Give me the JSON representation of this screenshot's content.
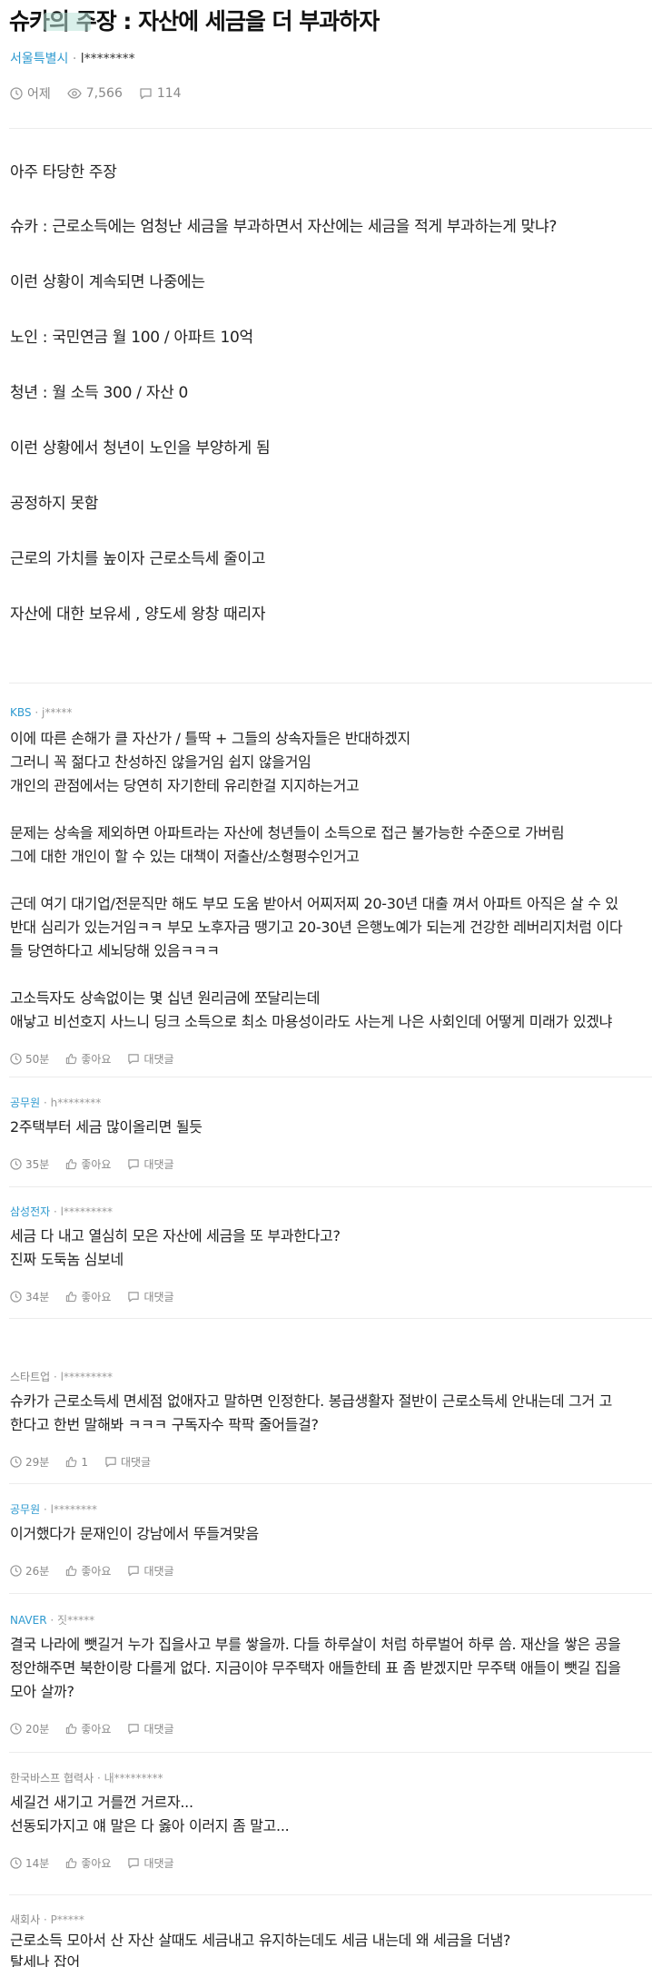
{
  "post": {
    "title": "슈카의 주장 : 자산에 세금을 더 부과하자",
    "company": "서울특별시",
    "separator": "·",
    "author_id": "l********",
    "time": "어제",
    "views": "7,566",
    "comments": "114",
    "body": [
      "아주 타당한 주장",
      "슈카 : 근로소득에는 엄청난 세금을 부과하면서 자산에는 세금을 적게 부과하는게 맞냐?",
      "이런 상황이 계속되면 나중에는",
      "노인 : 국민연금 월 100 / 아파트 10억",
      "청년 : 월 소득 300 / 자산 0",
      "이런 상황에서 청년이 노인을 부양하게 됨",
      "공정하지 못함",
      "근로의 가치를 높이자 근로소득세 줄이고",
      "자산에 대한 보유세 , 양도세 왕창 때리자"
    ]
  },
  "comments": [
    {
      "company": "KBS",
      "author_id": "j*****",
      "lines": [
        "이에 따른 손해가 클 자산가 / 틀딱 + 그들의 상속자들은 반대하겠지",
        "그러니 꼭 젊다고 찬성하진 않을거임 쉽지 않을거임",
        "개인의 관점에서는 당연히 자기한테 유리한걸 지지하는거고",
        "",
        "문제는 상속을 제외하면 아파트라는 자산에 청년들이 소득으로 접근 불가능한 수준으로 가버림",
        "그에 대한 개인이 할 수 있는 대책이 저출산/소형평수인거고",
        "",
        "근데 여기 대기업/전문직만 해도 부모 도움 받아서 어찌저찌 20-30년 대출 껴서 아파트 아직은 살 수 있",
        "반대 심리가 있는거임ㅋㅋ 부모 노후자금 땡기고 20-30년 은행노예가 되는게 건강한 레버리지처럼 이다",
        "들 당연하다고 세뇌당해 있음ㅋㅋㅋ",
        "",
        "고소득자도 상속없이는 몇 십년 원리금에 쪼달리는데",
        "애낳고 비선호지 사느니 딩크 소득으로 최소 마용성이라도 사는게 나은 사회인데 어떻게 미래가 있겠냐"
      ],
      "time": "50분",
      "likes": "좋아요",
      "reply": "대댓글"
    },
    {
      "company": "공무원",
      "author_id": "h********",
      "lines": [
        "2주택부터 세금 많이올리면 될듯"
      ],
      "time": "35분",
      "likes": "좋아요",
      "reply": "대댓글"
    },
    {
      "company": "삼성전자",
      "author_id": "l*********",
      "lines": [
        "세금 다 내고 열심히 모은 자산에 세금을 또 부과한다고?",
        "진짜 도둑놈 심보네"
      ],
      "time": "34분",
      "likes": "좋아요",
      "reply": "대댓글"
    },
    {
      "company": "스타트업",
      "author_id": "l*********",
      "lines": [
        "슈카가 근로소득세 면세점 없애자고 말하면 인정한다. 봉급생활자 절반이 근로소득세 안내는데 그거 고",
        "한다고 한번 말해봐 ㅋㅋㅋ 구독자수 팍팍 줄어들걸?"
      ],
      "time": "29분",
      "likes": "1",
      "reply": "대댓글"
    },
    {
      "company": "공무원",
      "author_id": "l********",
      "lines": [
        "이거했다가 문재인이 강남에서 뚜들겨맞음"
      ],
      "time": "26분",
      "likes": "좋아요",
      "reply": "대댓글"
    },
    {
      "company": "NAVER",
      "author_id": "짓*****",
      "lines": [
        "결국 나라에 뺏길거 누가 집을사고 부를 쌓을까. 다들 하루살이 처럼 하루벌어 하루 씀. 재산을 쌓은 공을",
        "정안해주면 북한이랑 다를게 없다. 지금이야 무주택자 애들한테 표 좀 받겠지만 무주택 애들이 뺏길 집을",
        "모아 살까?"
      ],
      "time": "20분",
      "likes": "좋아요",
      "reply": "대댓글"
    },
    {
      "company": "한국바스프 협력사",
      "author_id": "내*********",
      "lines": [
        "세길건 새기고 거를껀 거르자...",
        "선동되가지고 얘 말은 다 옳아 이러지 좀 말고..."
      ],
      "time": "14분",
      "likes": "좋아요",
      "reply": "대댓글"
    },
    {
      "company": "새회사",
      "author_id": "P*****",
      "lines": [
        "근로소득 모아서 산 자산 살때도 세금내고 유지하는데도 세금 내는데 왜 세금을 더냄?",
        "탈세나 잡어"
      ],
      "time": "",
      "likes": "",
      "reply": ""
    }
  ]
}
